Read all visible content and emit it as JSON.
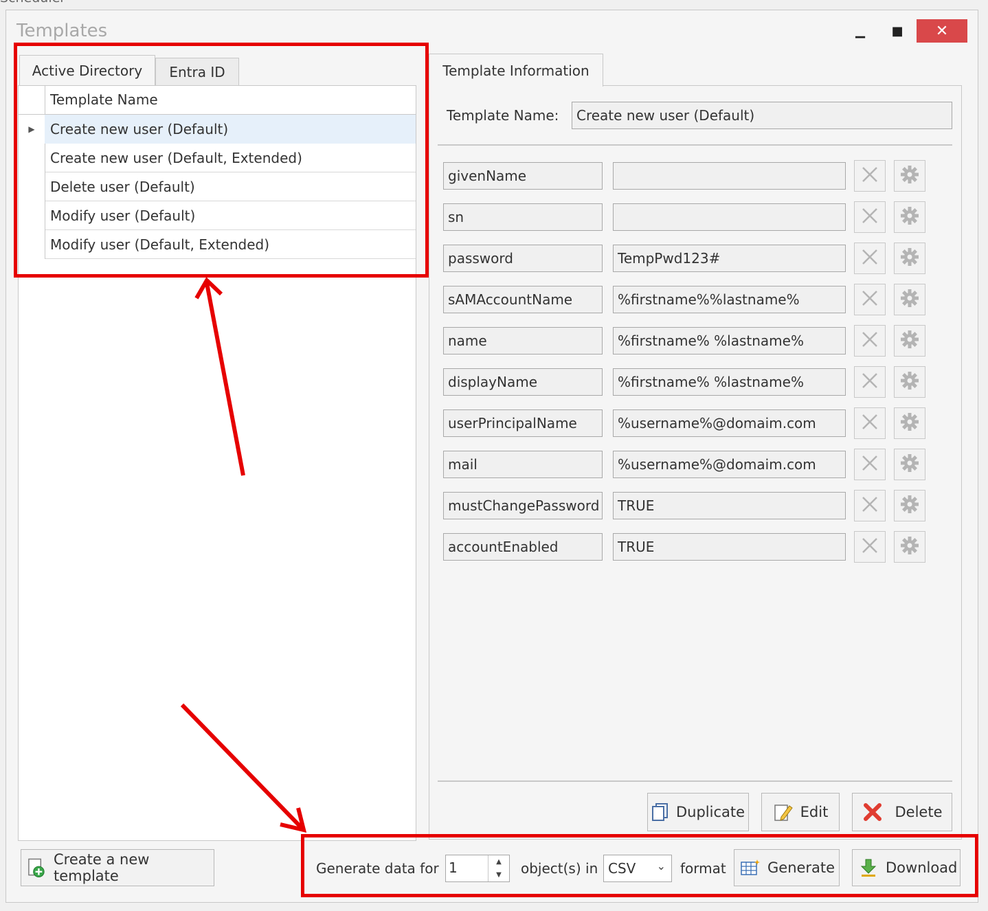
{
  "background_window": {
    "title": "Scheduler"
  },
  "dialog": {
    "title": "Templates",
    "controls": {
      "minimize": "▁",
      "maximize": "■",
      "close": "✕"
    }
  },
  "tabs_left": [
    {
      "label": "Active Directory",
      "active": true
    },
    {
      "label": "Entra ID",
      "active": false
    }
  ],
  "template_grid": {
    "column_header": "Template Name",
    "rows": [
      {
        "name": "Create new user (Default)",
        "selected": true
      },
      {
        "name": "Create new user (Default, Extended)",
        "selected": false
      },
      {
        "name": "Delete user (Default)",
        "selected": false
      },
      {
        "name": "Modify user (Default)",
        "selected": false
      },
      {
        "name": "Modify user (Default, Extended)",
        "selected": false
      }
    ]
  },
  "info_tab": {
    "label": "Template Information"
  },
  "template_info": {
    "name_label": "Template Name:",
    "name_value": "Create new user (Default)",
    "attributes": [
      {
        "name": "givenName",
        "value": ""
      },
      {
        "name": "sn",
        "value": ""
      },
      {
        "name": "password",
        "value": "TempPwd123#"
      },
      {
        "name": "sAMAccountName",
        "value": "%firstname%%lastname%"
      },
      {
        "name": "name",
        "value": "%firstname% %lastname%"
      },
      {
        "name": "displayName",
        "value": "%firstname% %lastname%"
      },
      {
        "name": "userPrincipalName",
        "value": "%username%@domaim.com"
      },
      {
        "name": "mail",
        "value": "%username%@domaim.com"
      },
      {
        "name": "mustChangePassword",
        "value": "TRUE"
      },
      {
        "name": "accountEnabled",
        "value": "TRUE"
      }
    ]
  },
  "actions": {
    "duplicate": "Duplicate",
    "edit": "Edit",
    "delete": "Delete"
  },
  "bottom": {
    "create_button": "Create a new template",
    "generate_label": "Generate data for",
    "count": "1",
    "objects_label": "object(s) in",
    "format": "CSV",
    "format_label": "format",
    "generate_button": "Generate",
    "download_button": "Download"
  },
  "colors": {
    "annotation": "#e60000",
    "selection": "#e6f0fa",
    "close_button": "#d9484a"
  }
}
